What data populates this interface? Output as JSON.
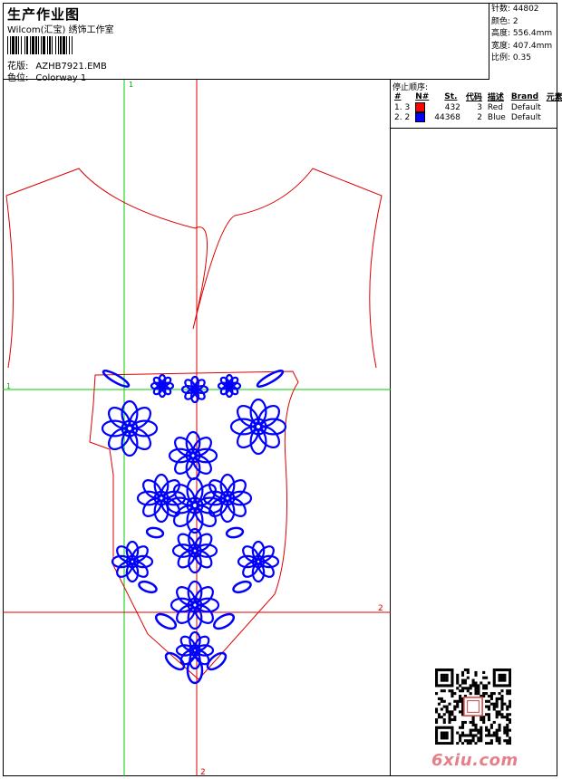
{
  "header": {
    "title": "生产作业图",
    "subtitle": "Wilcom(汇宝) 绣饰工作室",
    "design_label": "花版:",
    "design_value": "AZHB7921.EMB",
    "colorway_label": "色位:",
    "colorway_value": "Colorway 1"
  },
  "stats": {
    "stitches": "针数: 44802",
    "colors": "颜色: 2",
    "height": "高度: 556.4mm",
    "width": "宽度: 407.4mm",
    "scale": "比例: 0.35"
  },
  "stop_sequence": {
    "title": "停止顺序:",
    "columns": [
      "#",
      "N#",
      "St.",
      "代码",
      "描述",
      "Brand",
      "元素"
    ],
    "rows": [
      {
        "index": "1. 3",
        "swatch": "#ff0000",
        "stitches": "432",
        "code": "3",
        "desc": "Red",
        "brand": "Default"
      },
      {
        "index": "2. 2",
        "swatch": "#0000ff",
        "stitches": "44368",
        "code": "2",
        "desc": "Blue",
        "brand": "Default"
      }
    ]
  },
  "guides": {
    "v_top": "1",
    "h_left": "1",
    "h_right": "2",
    "v_bottom": "2"
  },
  "colors": {
    "outline": "#dd0000",
    "embroidery": "#0000ff",
    "guide": "#00cc00",
    "watermark": "#e4808a"
  },
  "watermark": "6xiu.com"
}
